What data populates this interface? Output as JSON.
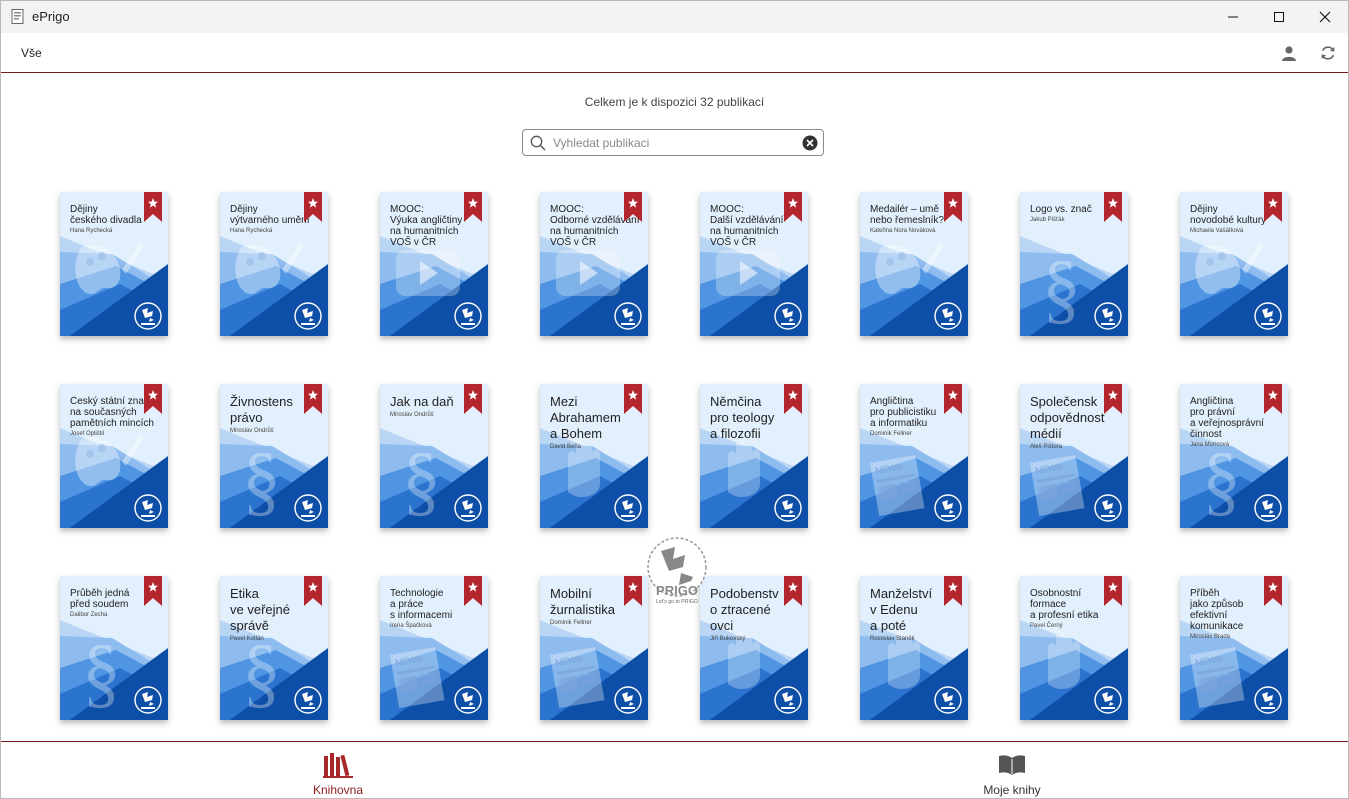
{
  "window": {
    "title": "ePrigo"
  },
  "toolbar": {
    "filter_label": "Vše"
  },
  "library": {
    "count_text": "Celkem je k dispozici 32 publikací",
    "search_placeholder": "Vyhledat publikaci",
    "books": [
      {
        "title_lines": [
          "Dějiny",
          "českého divadla"
        ],
        "author": "Hana Rychecká",
        "motif": "palette",
        "big": false
      },
      {
        "title_lines": [
          "Dějiny",
          "výtvarného umění"
        ],
        "author": "Hana Rychecká",
        "motif": "palette",
        "big": false
      },
      {
        "title_lines": [
          "MOOC:",
          "Výuka angličtiny",
          "na humanitních",
          "VOŠ v ČR"
        ],
        "author": "",
        "motif": "play",
        "big": false
      },
      {
        "title_lines": [
          "MOOC:",
          "Odborné vzdělávání",
          "na humanitních",
          "VOŠ v ČR"
        ],
        "author": "",
        "motif": "play",
        "big": false
      },
      {
        "title_lines": [
          "MOOC:",
          "Další vzdělávání",
          "na humanitních",
          "VOŠ v ČR"
        ],
        "author": "",
        "motif": "play",
        "big": false
      },
      {
        "title_lines": [
          "Medailér – umě",
          "nebo řemeslník?"
        ],
        "author": "Kateřina Nora Nováková",
        "motif": "palette",
        "big": false
      },
      {
        "title_lines": [
          "Logo vs. znač"
        ],
        "author": "Jakub Pišťák",
        "motif": "section",
        "big": false
      },
      {
        "title_lines": [
          "Dějiny",
          "novodobé kultury"
        ],
        "author": "Michaela Vašátková",
        "motif": "palette",
        "big": false
      },
      {
        "title_lines": [
          "Český státní zna",
          "na současných",
          "pamětních mincích"
        ],
        "author": "Josef Oplištil",
        "motif": "palette",
        "big": false
      },
      {
        "title_lines": [
          "Živnostens",
          "právo"
        ],
        "author": "Miroslav Ondrůš",
        "motif": "section",
        "big": true
      },
      {
        "title_lines": [
          "Jak na daň"
        ],
        "author": "Miroslav Ondrůš",
        "motif": "section",
        "big": true
      },
      {
        "title_lines": [
          "Mezi",
          "Abrahamem",
          "a Bohem"
        ],
        "author": "David Beňa",
        "motif": "hand",
        "big": true
      },
      {
        "title_lines": [
          "Němčina",
          "pro teology",
          "a filozofii"
        ],
        "author": "",
        "motif": "hand",
        "big": true
      },
      {
        "title_lines": [
          "Angličtina",
          "pro publicistiku",
          "a informatiku"
        ],
        "author": "Dominik Fellner",
        "motif": "news",
        "big": false
      },
      {
        "title_lines": [
          "Společensk",
          "odpovědnost",
          "médií"
        ],
        "author": "Aleš Pištora",
        "motif": "news",
        "big": true
      },
      {
        "title_lines": [
          "Angličtina",
          "pro právní",
          "a veřejnosprávní",
          "činnost"
        ],
        "author": "Jana Moricová",
        "motif": "section",
        "big": false
      },
      {
        "title_lines": [
          "Průběh jedná",
          "před soudem"
        ],
        "author": "Dalibor Zecha",
        "motif": "section",
        "big": false
      },
      {
        "title_lines": [
          "Etika",
          "ve veřejné",
          "správě"
        ],
        "author": "Pavel Kotlán",
        "motif": "section",
        "big": true
      },
      {
        "title_lines": [
          "Technologie",
          "a práce",
          "s informacemi"
        ],
        "author": "Irena Špačková",
        "motif": "news",
        "big": false
      },
      {
        "title_lines": [
          "Mobilní",
          "žurnalistika"
        ],
        "author": "Dominik Fellner",
        "motif": "news",
        "big": true
      },
      {
        "title_lines": [
          "Podobenstv",
          "o ztracené",
          "ovci"
        ],
        "author": "Jiří Bukovský",
        "motif": "hand",
        "big": true
      },
      {
        "title_lines": [
          "Manželství",
          "v Edenu",
          "a poté"
        ],
        "author": "Rostislav Staněk",
        "motif": "hand",
        "big": true
      },
      {
        "title_lines": [
          "Osobnostní",
          "formace",
          "a profesní etika"
        ],
        "author": "Pavel Černý",
        "motif": "hand",
        "big": false
      },
      {
        "title_lines": [
          "Příběh",
          "jako způsob",
          "efektivní",
          "komunikace"
        ],
        "author": "Miroslav Brada",
        "motif": "news",
        "big": false
      }
    ]
  },
  "overlay": {
    "brand": "PRIGO",
    "tagline": "Let's go to PRIGO"
  },
  "nav": {
    "library_label": "Knihovna",
    "my_books_label": "Moje knihy"
  },
  "colors": {
    "accent": "#7a1c1c",
    "ribbon": "#b3262d",
    "cover_dark": "#0d4ea6",
    "cover_light": "#dcecfb"
  }
}
